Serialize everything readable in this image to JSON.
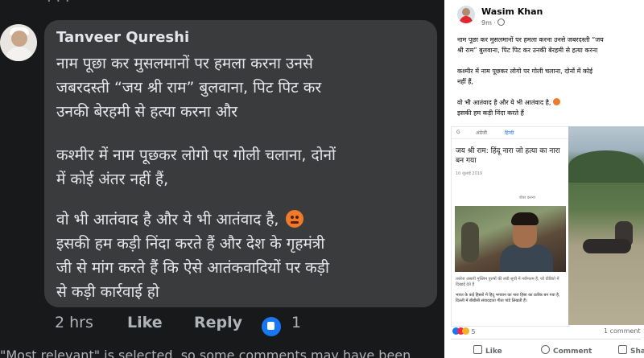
{
  "comment": {
    "author": "Tanveer Qureshi",
    "top_cut_text": "",
    "lines": [
      "नाम पूछा कर मुसलमानों पर हमला करना उनसे",
      "जबरदस्ती “जय श्री राम” बुलवाना, पिट पिट कर",
      "उनकी बेरहमी से हत्या करना और",
      "कश्मीर में नाम पूछकर लोगो पर गोली चलाना, दोनों",
      "में कोई अंतर नहीं हैं,",
      "वो भी आतंवाद है और ये भी आतंवाद है,",
      "इसकी हम कड़ी निंदा करते हैं और देश के गृहमंत्री",
      "जी से मांग करते हैं कि ऐसे आतंकवादियों पर कड़ी",
      "से कड़ी कार्रवाई हो"
    ],
    "time": "2 hrs",
    "like_label": "Like",
    "reply_label": "Reply",
    "like_count": "1",
    "bottom_notice": "\"Most relevant\" is selected, so some comments may have been"
  },
  "post": {
    "author": "Wasim Khan",
    "time": "9m ·",
    "text_lines": [
      "नाम पूछा कर मुसलमानों पर हमला करना उनसे जबरदस्ती “जय",
      "श्री राम” बुलवाना, पिट पिट कर उनकी बेरहमी से हत्या करना",
      "कश्मीर में नाम पूछकर लोगो पर गोली चलाना, दोनों में कोई",
      "नहीं हैं,",
      "वो भी आतंवाद है और ये भी आतंवाद है,",
      "इसकी हम कड़ी निंदा करते हैं"
    ],
    "news": {
      "tab1": "अंग्रेजी",
      "tab2": "हिन्दी",
      "headline": "जय श्री राम: हिंदू नारा जो हत्या का नारा बन गया",
      "date": "10 जुलाई 2019",
      "share": "शेयर करना",
      "caption": "तबरेज अंसारी मुस्लिम पुरुषों की लंबी सूची में नवीनतम हैं, जो वीडियो में दिखाई देते हैं",
      "body": "भारत के कई हिस्सों में हिंदू भगवान का नारा हिंसा का प्रतीक बन गया है, दिल्ली में बीबीसी संवाददाता गीता पांडे लिखती हैं।"
    },
    "reaction_count": "5",
    "comments_count": "1 comment",
    "buttons": [
      "Like",
      "Comment",
      "Share"
    ]
  },
  "colors": {
    "dark_bg": "#18191a",
    "bubble": "#3a3b3c",
    "text_light": "#e4e6eb",
    "fb_blue": "#1877f2"
  }
}
